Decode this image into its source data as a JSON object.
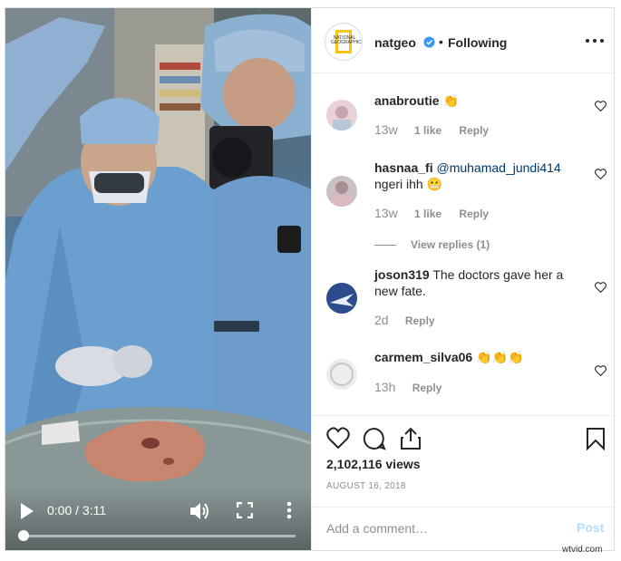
{
  "video": {
    "time": "0:00 / 3:11",
    "progress_fraction": 0.0
  },
  "post": {
    "username": "natgeo",
    "separator": "•",
    "follow_status": "Following",
    "logo_text": "NATIONAL GEOGRAPHIC",
    "views": "2,102,116 views",
    "date": "AUGUST 16, 2018"
  },
  "comments": [
    {
      "username": "anabroutie",
      "text": "👏",
      "age": "13w",
      "likes": "1 like",
      "reply": "Reply"
    },
    {
      "username": "hasnaa_fi",
      "mention": "@muhamad_jundi414",
      "text": "ngeri ihh 😬",
      "age": "13w",
      "likes": "1 like",
      "reply": "Reply",
      "view_replies": "View replies (1)"
    },
    {
      "username": "joson319",
      "text": "The doctors gave her a new fate.",
      "age": "2d",
      "reply": "Reply"
    },
    {
      "username": "carmem_silva06",
      "text": "👏👏👏",
      "age": "13h",
      "reply": "Reply"
    }
  ],
  "add_comment": {
    "placeholder": "Add a comment…",
    "post_label": "Post"
  },
  "watermark": "wtvid.com",
  "colors": {
    "verified": "#3897f0",
    "link": "#00376b",
    "muted": "#8e8e8e",
    "post_disabled": "#b2dffc"
  }
}
